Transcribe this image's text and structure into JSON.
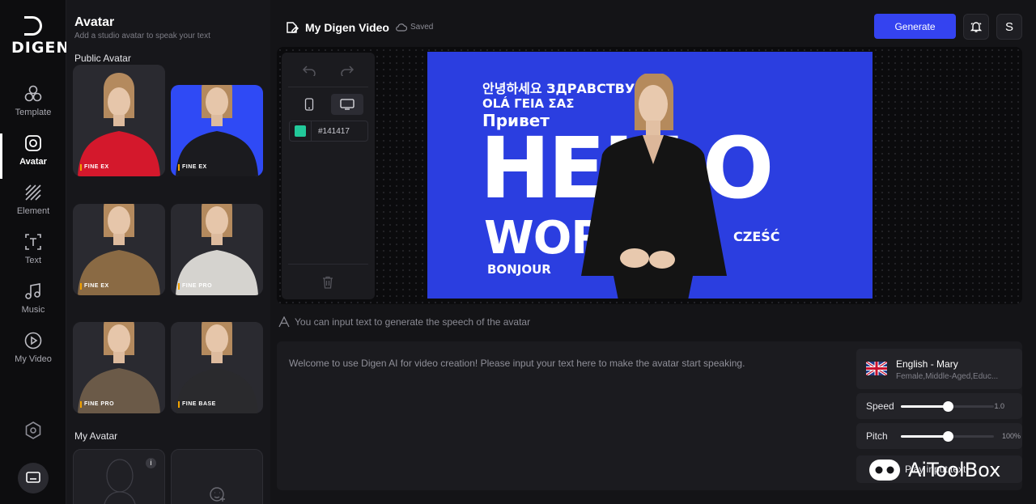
{
  "rail": {
    "logo": "DIGEN",
    "items": [
      {
        "label": "Template",
        "icon": "template-icon"
      },
      {
        "label": "Avatar",
        "icon": "avatar-icon",
        "active": true
      },
      {
        "label": "Element",
        "icon": "element-icon"
      },
      {
        "label": "Text",
        "icon": "text-icon"
      },
      {
        "label": "Music",
        "icon": "music-icon"
      },
      {
        "label": "My Video",
        "icon": "play-icon"
      }
    ]
  },
  "panel": {
    "title": "Avatar",
    "subtitle": "Add a studio avatar to speak your text",
    "public_title": "Public Avatar",
    "public_avatars": [
      {
        "badge": "FINE EX",
        "shirt": "#d4182c",
        "bg": "#2a2a30"
      },
      {
        "badge": "FINE EX",
        "shirt": "#1b1b1f",
        "bg": "#2f4af5"
      },
      {
        "badge": "FINE EX",
        "shirt": "#8a6a44",
        "bg": "#2a2a30"
      },
      {
        "badge": "FINE PRO",
        "shirt": "#d5d3cf",
        "bg": "#2a2a30"
      },
      {
        "badge": "FINE PRO",
        "shirt": "#6b5a48",
        "bg": "#2a2a30"
      },
      {
        "badge": "FINE BASE",
        "shirt": "#2a2a2d",
        "bg": "#2a2a30"
      }
    ],
    "my_title": "My Avatar"
  },
  "header": {
    "project_title": "My Digen Video",
    "saved": "Saved",
    "generate": "Generate",
    "user_initial": "S"
  },
  "tools": {
    "color_value": "#141417"
  },
  "canvas": {
    "greet1": "안녕하세요  ЗДРАВСТВУЙ",
    "greet2": "OLÁ  ΓΕΙΑ ΣΑΣ",
    "greet3": "Привет",
    "hello": "HELLO",
    "world": "WORLD",
    "czesc": "CZEŚĆ",
    "bonjour": "BONJOUR"
  },
  "editor": {
    "hint": "You can input text to generate the speech of the avatar",
    "placeholder": "Welcome to use Digen AI for video creation! Please input your text here to make the avatar start speaking.",
    "voice_name": "English - Mary",
    "voice_desc": "Female,Middle-Aged,Educ...",
    "speed_label": "Speed",
    "speed_value": "1.0",
    "speed_fraction": 0.5,
    "pitch_label": "Pitch",
    "pitch_value": "100%",
    "pitch_fraction": 0.5,
    "play_label": "Play input text"
  },
  "watermark": "AiToolBox"
}
